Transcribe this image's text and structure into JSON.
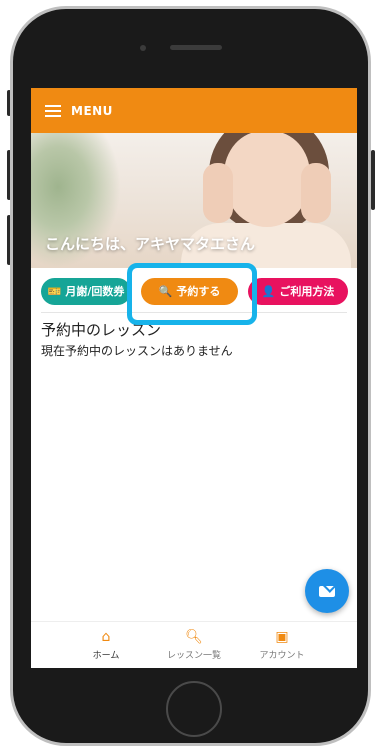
{
  "topbar": {
    "menu_label": "MENU"
  },
  "hero": {
    "greeting": "こんにちは、アキヤマタエさん"
  },
  "tabs": [
    {
      "label": "月謝/回数券",
      "icon": "ticket-icon",
      "color": "#16a597"
    },
    {
      "label": "予約する",
      "icon": "search-icon",
      "color": "#f08a12"
    },
    {
      "label": "ご利用方法",
      "icon": "guide-icon",
      "color": "#e8125f"
    }
  ],
  "reservations": {
    "title": "予約中のレッスン",
    "empty_message": "現在予約中のレッスンはありません"
  },
  "fab": {
    "icon": "mail-icon",
    "color": "#1e8fe6"
  },
  "bottom_nav": [
    {
      "label": "ホーム",
      "icon": "home-icon"
    },
    {
      "label": "レッスン一覧",
      "icon": "search-icon"
    },
    {
      "label": "アカウント",
      "icon": "account-icon"
    }
  ],
  "colors": {
    "accent": "#f08a12",
    "highlight": "#17b3ea"
  }
}
